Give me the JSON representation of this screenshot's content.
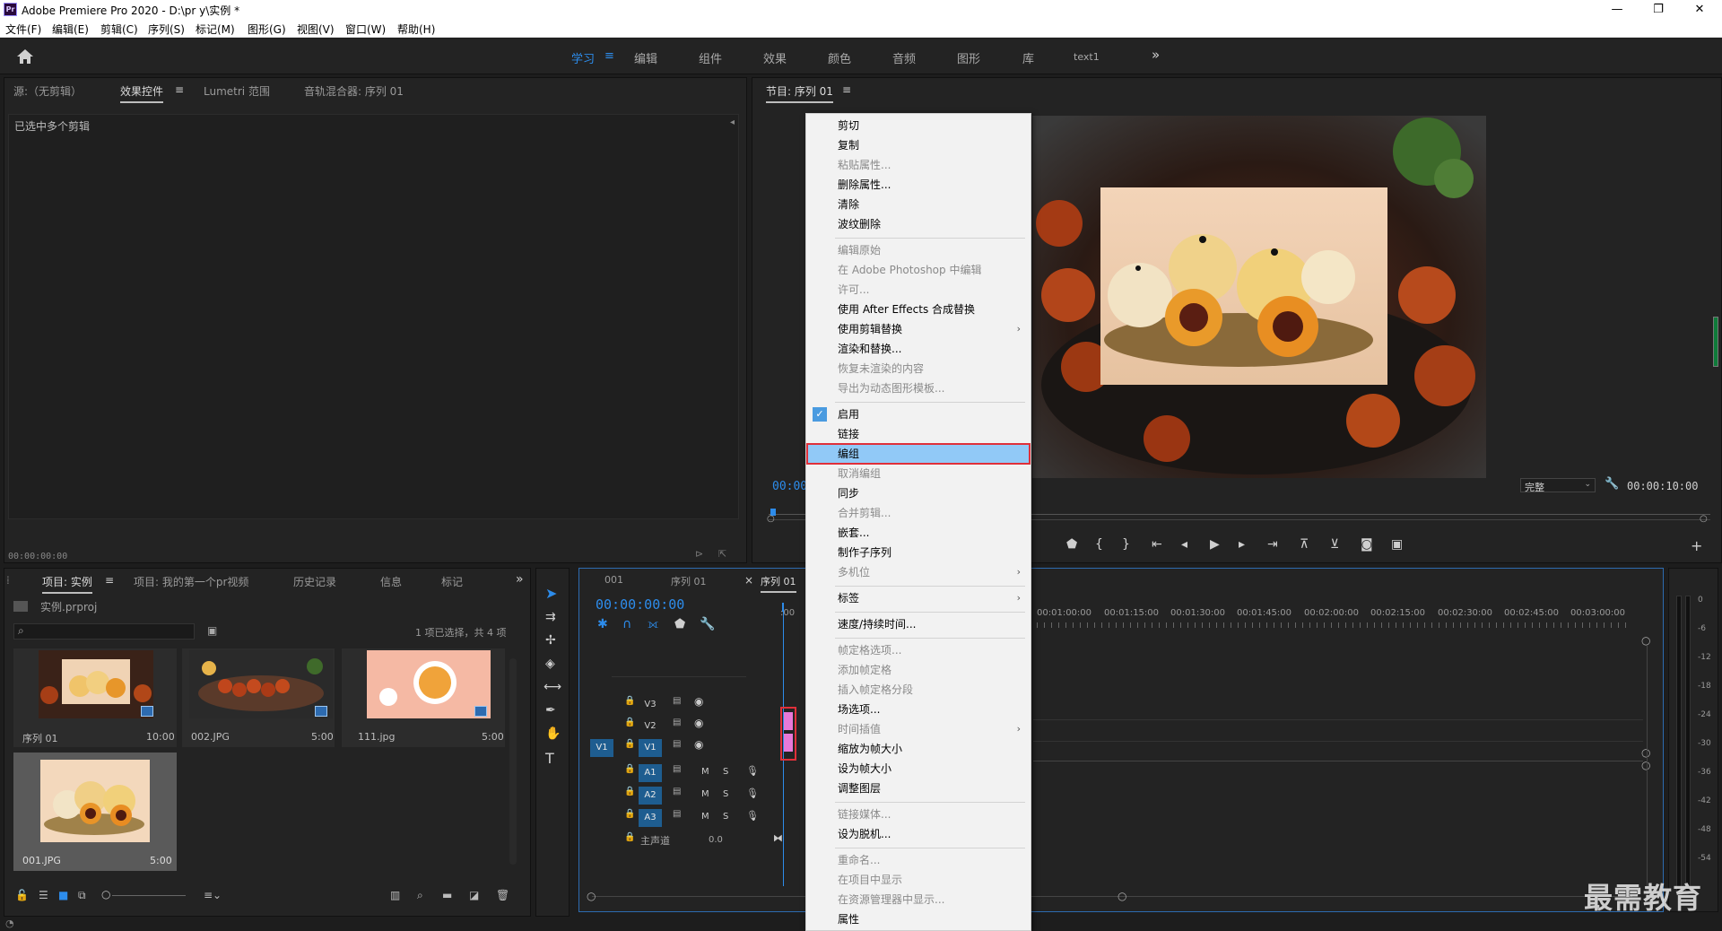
{
  "app": {
    "title": "Adobe Premiere Pro 2020 - D:\\pr y\\实例 *",
    "logo": "Pr",
    "window_controls": {
      "minimize": "—",
      "maximize": "❐",
      "close": "✕"
    }
  },
  "menu": [
    "文件(F)",
    "编辑(E)",
    "剪辑(C)",
    "序列(S)",
    "标记(M)",
    "图形(G)",
    "视图(V)",
    "窗口(W)",
    "帮助(H)"
  ],
  "workspaces": {
    "items": [
      "学习",
      "编辑",
      "组件",
      "效果",
      "颜色",
      "音频",
      "图形",
      "库",
      "text1"
    ],
    "active_index": 0,
    "active_menu_glyph": "≡",
    "more_glyph": "»"
  },
  "source_panel": {
    "tabs": [
      "源:（无剪辑）",
      "效果控件",
      "Lumetri 范围",
      "音轨混合器: 序列 01"
    ],
    "active_tab": 1,
    "menu_glyph": "≡",
    "header": "已选中多个剪辑",
    "timecode": "00:00:00:00"
  },
  "program_monitor": {
    "title": "节目: 序列 01",
    "menu_glyph": "≡",
    "timecode_left": "00:00",
    "zoom": "完整",
    "duration": "00:00:10:00"
  },
  "project_panel": {
    "tabs": [
      "项目: 实例",
      "项目: 我的第一个pr视频",
      "历史记录",
      "信息",
      "标记"
    ],
    "active_tab": 0,
    "menu_glyph": "≡",
    "file": "实例.prproj",
    "selection_info": "1 项已选择，共 4 项",
    "items": [
      {
        "name": "序列 01",
        "duration": "10:00"
      },
      {
        "name": "002.JPG",
        "duration": "5:00"
      },
      {
        "name": "111.jpg",
        "duration": "5:00"
      },
      {
        "name": "001.JPG",
        "duration": "5:00"
      }
    ]
  },
  "timeline": {
    "tabs": [
      "001",
      "序列 01",
      "序列 01"
    ],
    "active_tab": 2,
    "close_glyph": "×",
    "timecode": "00:00:00:00",
    "ruler": [
      "00:01:00:00",
      "00:01:15:00",
      "00:01:30:00",
      "00:01:45:00",
      "00:02:00:00",
      "00:02:15:00",
      "00:02:30:00",
      "00:02:45:00",
      "00:03:00:00"
    ],
    "video_tracks": [
      "V3",
      "V2",
      "V1"
    ],
    "audio_tracks": [
      "A1",
      "A2",
      "A3"
    ],
    "source_patch": "V1",
    "master": {
      "label": "主声道",
      "value": "0.0"
    },
    "track_buttons": {
      "mute": "M",
      "solo": "S"
    }
  },
  "audio_meter": {
    "scale": [
      "0",
      "-6",
      "-12",
      "-18",
      "-24",
      "-30",
      "-36",
      "-42",
      "-48",
      "-54"
    ]
  },
  "context_menu": {
    "items": [
      {
        "label": "剪切",
        "enabled": true
      },
      {
        "label": "复制",
        "enabled": true
      },
      {
        "label": "粘贴属性...",
        "enabled": false
      },
      {
        "label": "删除属性...",
        "enabled": true
      },
      {
        "label": "清除",
        "enabled": true
      },
      {
        "label": "波纹删除",
        "enabled": true
      },
      {
        "label": "编辑原始",
        "enabled": false
      },
      {
        "label": "在 Adobe Photoshop 中编辑",
        "enabled": false
      },
      {
        "label": "许可...",
        "enabled": false
      },
      {
        "label": "使用 After Effects 合成替换",
        "enabled": true
      },
      {
        "label": "使用剪辑替换",
        "enabled": true,
        "submenu": true
      },
      {
        "label": "渲染和替换...",
        "enabled": true
      },
      {
        "label": "恢复未渲染的内容",
        "enabled": false
      },
      {
        "label": "导出为动态图形模板...",
        "enabled": false
      },
      {
        "label": "启用",
        "enabled": true,
        "checked": true
      },
      {
        "label": "链接",
        "enabled": true
      },
      {
        "label": "编组",
        "enabled": true,
        "highlighted": true
      },
      {
        "label": "取消编组",
        "enabled": false
      },
      {
        "label": "同步",
        "enabled": true
      },
      {
        "label": "合并剪辑...",
        "enabled": false
      },
      {
        "label": "嵌套...",
        "enabled": true
      },
      {
        "label": "制作子序列",
        "enabled": true
      },
      {
        "label": "多机位",
        "enabled": false,
        "submenu": true
      },
      {
        "label": "标签",
        "enabled": true,
        "submenu": true
      },
      {
        "label": "速度/持续时间...",
        "enabled": true
      },
      {
        "label": "帧定格选项...",
        "enabled": false
      },
      {
        "label": "添加帧定格",
        "enabled": false
      },
      {
        "label": "插入帧定格分段",
        "enabled": false
      },
      {
        "label": "场选项...",
        "enabled": true
      },
      {
        "label": "时间插值",
        "enabled": false,
        "submenu": true
      },
      {
        "label": "缩放为帧大小",
        "enabled": true
      },
      {
        "label": "设为帧大小",
        "enabled": true
      },
      {
        "label": "调整图层",
        "enabled": true
      },
      {
        "label": "链接媒体...",
        "enabled": false
      },
      {
        "label": "设为脱机...",
        "enabled": true
      },
      {
        "label": "重命名...",
        "enabled": false
      },
      {
        "label": "在项目中显示",
        "enabled": false
      },
      {
        "label": "在资源管理器中显示...",
        "enabled": false
      },
      {
        "label": "属性",
        "enabled": true
      }
    ],
    "check_glyph": "✓",
    "submenu_glyph": "›"
  },
  "watermark": "最需教育",
  "colors": {
    "accent": "#2d8ceb",
    "highlight": "#91c9f7",
    "highlight_border": "#e0303a",
    "clip_pink": "#e879d8"
  }
}
